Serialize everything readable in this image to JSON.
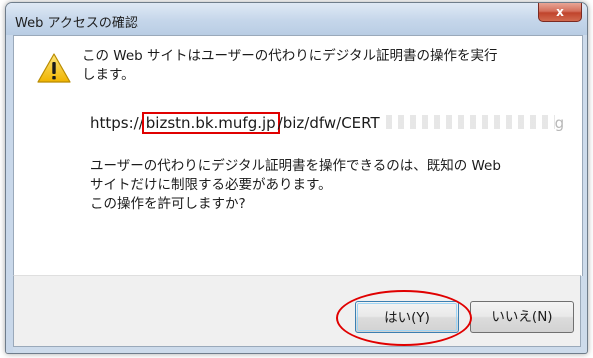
{
  "dialog": {
    "title": "Web アクセスの確認",
    "close_glyph": "x",
    "message_line1": "この Web サイトはユーザーの代わりにデジタル証明書の操作を実行",
    "message_line2": "します。",
    "url_prefix": "https://",
    "url_host": "bizstn.bk.mufg.jp",
    "url_path": "/biz/dfw/CERT",
    "url_tail": "g",
    "info_line1": "ユーザーの代わりにデジタル証明書を操作できるのは、既知の Web",
    "info_line2": "サイトだけに制限する必要があります。",
    "info_line3": "この操作を許可しますか?",
    "yes_label": "はい(Y)",
    "no_label": "いいえ(N)"
  },
  "colors": {
    "annotation": "#e00000",
    "warning": "#f4c400"
  },
  "icons": {
    "warning": "warning-icon",
    "close": "close-icon"
  }
}
